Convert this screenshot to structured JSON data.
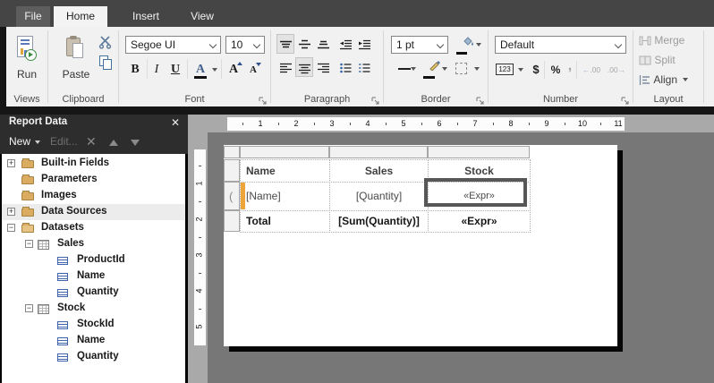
{
  "window": {
    "tabs": [
      {
        "label": "File"
      },
      {
        "label": "Home"
      },
      {
        "label": "Insert"
      },
      {
        "label": "View"
      }
    ]
  },
  "ribbon": {
    "views": {
      "label": "Views",
      "run_label": "Run"
    },
    "clipboard": {
      "label": "Clipboard",
      "paste_label": "Paste"
    },
    "font": {
      "label": "Font",
      "family_value": "Segoe UI",
      "size_value": "10",
      "bold": "B",
      "italic": "I",
      "underline": "U",
      "font_color": "A",
      "grow_font": "A",
      "shrink_font": "A"
    },
    "paragraph": {
      "label": "Paragraph"
    },
    "border": {
      "label": "Border",
      "width_value": "1 pt"
    },
    "number": {
      "label": "Number",
      "format_value": "Default",
      "general": "123",
      "currency": "$",
      "percent": "%",
      "thousands": ",",
      "decrease_decimal": ".00",
      "increase_decimal": ".00"
    },
    "layout": {
      "label": "Layout",
      "merge_label": "Merge",
      "split_label": "Split",
      "align_label": "Align"
    }
  },
  "report_data_panel": {
    "title": "Report Data",
    "close_icon": "✕",
    "toolbar": {
      "new_label": "New",
      "edit_label": "Edit...",
      "delete_icon": "✕"
    },
    "tree": [
      {
        "label": "Built-in Fields"
      },
      {
        "label": "Parameters"
      },
      {
        "label": "Images"
      },
      {
        "label": "Data Sources"
      },
      {
        "label": "Datasets"
      },
      {
        "label": "Sales"
      },
      {
        "label": "ProductId"
      },
      {
        "label": "Name"
      },
      {
        "label": "Quantity"
      },
      {
        "label": "Stock"
      },
      {
        "label": "StockId"
      },
      {
        "label": "Name"
      },
      {
        "label": "Quantity"
      }
    ]
  },
  "design_surface": {
    "h_ruler_numbers": [
      "1",
      "2",
      "3",
      "4",
      "5",
      "6",
      "7",
      "8",
      "9",
      "10",
      "11"
    ],
    "v_ruler_numbers": [
      "1",
      "2",
      "3",
      "4",
      "5"
    ],
    "table": {
      "detail_indicator": "(",
      "header_row": [
        "Name",
        "Sales",
        "Stock"
      ],
      "detail_row": [
        "[Name]",
        "[Quantity]",
        "«Expr»"
      ],
      "total_row": [
        "Total",
        "[Sum(Quantity)]",
        "«Expr»"
      ]
    }
  },
  "colors": {
    "titlebar": "#454545",
    "panel_dark": "#2D2D2D",
    "folder_tan": "#D9AC62",
    "accent_orange": "#EDA53A",
    "selection_border": "#575757",
    "design_background": "#777777"
  }
}
